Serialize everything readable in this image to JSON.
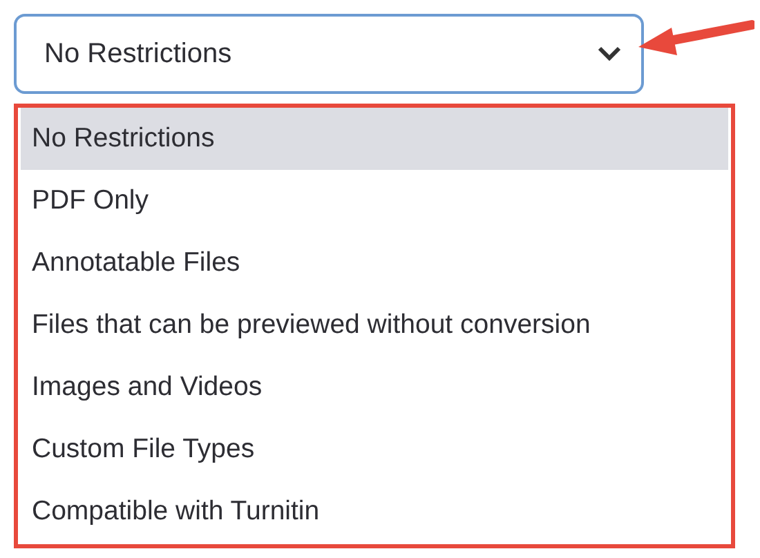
{
  "dropdown": {
    "value": "No Restrictions",
    "options": [
      {
        "label": "No Restrictions",
        "selected": true
      },
      {
        "label": "PDF Only",
        "selected": false
      },
      {
        "label": "Annotatable Files",
        "selected": false
      },
      {
        "label": "Files that can be previewed without conversion",
        "selected": false
      },
      {
        "label": "Images and Videos",
        "selected": false
      },
      {
        "label": "Custom File Types",
        "selected": false
      },
      {
        "label": "Compatible with Turnitin",
        "selected": false
      }
    ]
  }
}
